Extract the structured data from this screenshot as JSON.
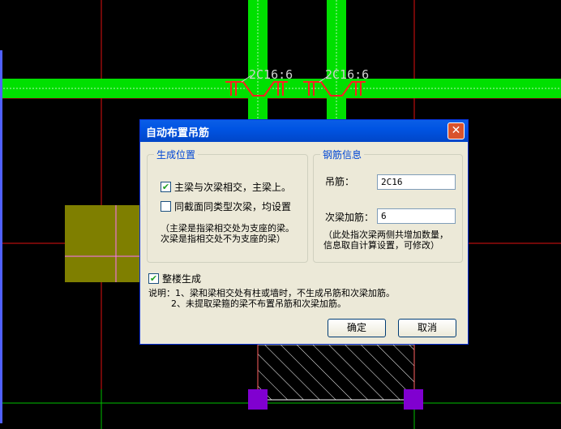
{
  "cad": {
    "rebar_labels": [
      "2C16:6",
      "2C16:6"
    ]
  },
  "dialog": {
    "title": "自动布置吊筋",
    "close_glyph": "✕",
    "position_group": {
      "title": "生成位置",
      "opt1_label": "主梁与次梁相交，主梁上。",
      "opt1_checked": true,
      "opt2_label": "同截面同类型次梁，均设置",
      "opt2_checked": false,
      "note": "（主梁是指梁相交处为支座的梁。\n次梁是指相交处不为支座的梁）"
    },
    "rebar_group": {
      "title": "钢筋信息",
      "hanger_label": "吊筋：",
      "hanger_value": "2C16",
      "secondary_label": "次梁加筋：",
      "secondary_value": "6",
      "note": "（此处指次梁两侧共增加数量，\n信息取自计算设置，可修改）"
    },
    "whole_building_label": "整楼生成",
    "whole_building_checked": true,
    "explain": "说明：1、梁和梁相交处有柱或墙时，不生成吊筋和次梁加筋。\n        2、未提取梁箍的梁不布置吊筋和次梁加筋。",
    "ok_label": "确定",
    "cancel_label": "取消"
  }
}
